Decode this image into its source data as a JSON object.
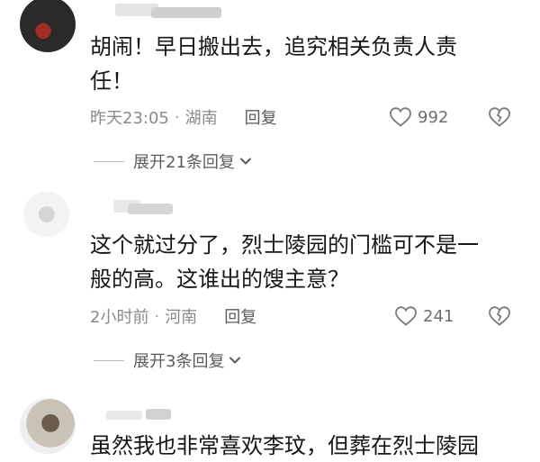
{
  "comments": [
    {
      "text_lines": [
        "胡闹！早日搬出去，追究相关负责人责",
        "任！"
      ],
      "time": "昨天23:05",
      "location": "湖南",
      "reply_label": "回复",
      "likes": "992",
      "expand_label": "展开21条回复"
    },
    {
      "text_lines": [
        "这个就过分了，烈士陵园的门槛可不是一",
        "般的高。这谁出的馊主意？"
      ],
      "time": "2小时前",
      "location": "河南",
      "reply_label": "回复",
      "likes": "241",
      "expand_label": "展开3条回复"
    },
    {
      "text_lines": [
        "虽然我也非常喜欢李玟，但葬在烈士陵园"
      ]
    }
  ],
  "separator": "·",
  "icons": {
    "like": "heart-outline-icon",
    "dislike": "broken-heart-icon",
    "expand": "chevron-down-icon"
  },
  "colors": {
    "text": "#161616",
    "meta": "#8a8a8a",
    "secondary": "#5c5c5c"
  }
}
